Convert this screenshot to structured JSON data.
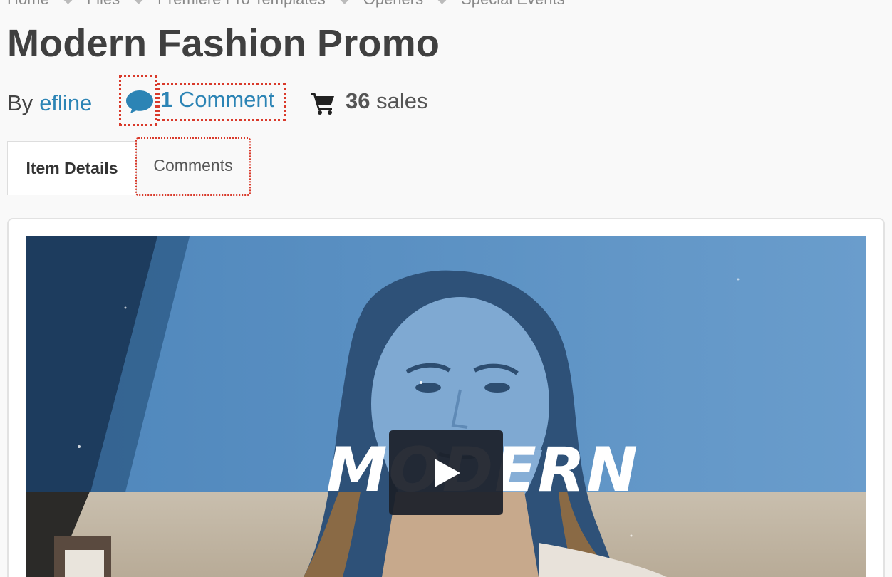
{
  "breadcrumb": {
    "items": [
      {
        "label": "Home"
      },
      {
        "label": "Files"
      },
      {
        "label": "Premiere Pro Templates"
      },
      {
        "label": "Openers"
      },
      {
        "label": "Special Events"
      }
    ]
  },
  "item": {
    "title": "Modern Fashion Promo",
    "by_label": "By",
    "author": "efline",
    "comment_count": "1",
    "comment_label": "Comment",
    "sales_count": "36",
    "sales_label": "sales"
  },
  "tabs": [
    {
      "label": "Item Details",
      "active": true
    },
    {
      "label": "Comments",
      "active": false
    }
  ],
  "preview": {
    "overlay_word": "MODERN",
    "play_icon": "play-icon"
  },
  "colors": {
    "link": "#2c84b5",
    "highlight_border": "#d93a2b",
    "title": "#404040"
  }
}
